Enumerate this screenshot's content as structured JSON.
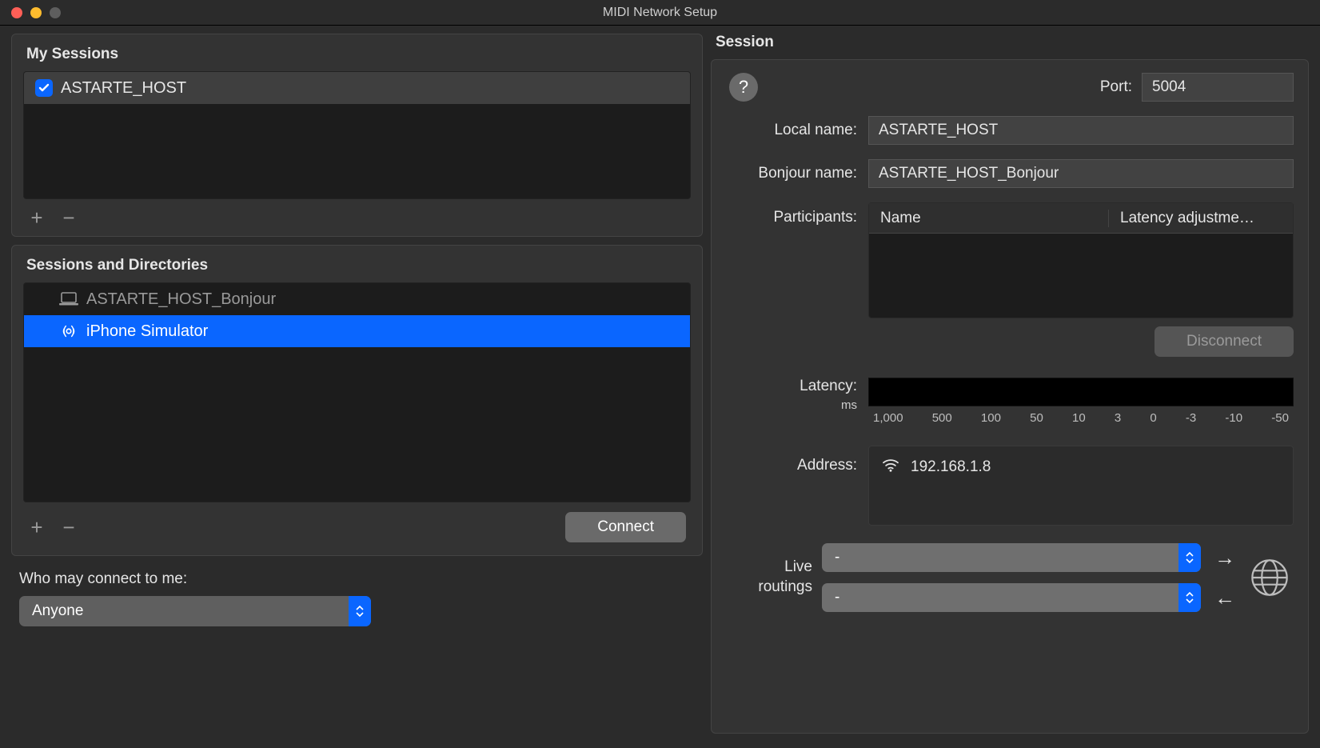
{
  "window": {
    "title": "MIDI Network Setup"
  },
  "mySessions": {
    "title": "My Sessions",
    "items": [
      {
        "name": "ASTARTE_HOST",
        "checked": true
      }
    ]
  },
  "directories": {
    "title": "Sessions and Directories",
    "items": [
      {
        "name": "ASTARTE_HOST_Bonjour",
        "icon": "laptop",
        "selected": false,
        "dim": true
      },
      {
        "name": "iPhone Simulator",
        "icon": "bonjour",
        "selected": true,
        "dim": false
      }
    ],
    "connect_label": "Connect"
  },
  "who": {
    "label": "Who may connect to me:",
    "value": "Anyone"
  },
  "session": {
    "title": "Session",
    "port_label": "Port:",
    "port_value": "5004",
    "local_name_label": "Local name:",
    "local_name_value": "ASTARTE_HOST",
    "bonjour_name_label": "Bonjour name:",
    "bonjour_name_value": "ASTARTE_HOST_Bonjour",
    "participants_label": "Participants:",
    "participants_cols": {
      "name": "Name",
      "latency": "Latency adjustme…"
    },
    "disconnect_label": "Disconnect",
    "latency_label": "Latency:",
    "latency_unit": "ms",
    "latency_ticks": [
      "1,000",
      "500",
      "100",
      "50",
      "10",
      "3",
      "0",
      "-3",
      "-10",
      "-50"
    ],
    "address_label": "Address:",
    "address_value": "192.168.1.8",
    "routings_label_1": "Live",
    "routings_label_2": "routings",
    "route_out_value": "-",
    "route_in_value": "-"
  }
}
